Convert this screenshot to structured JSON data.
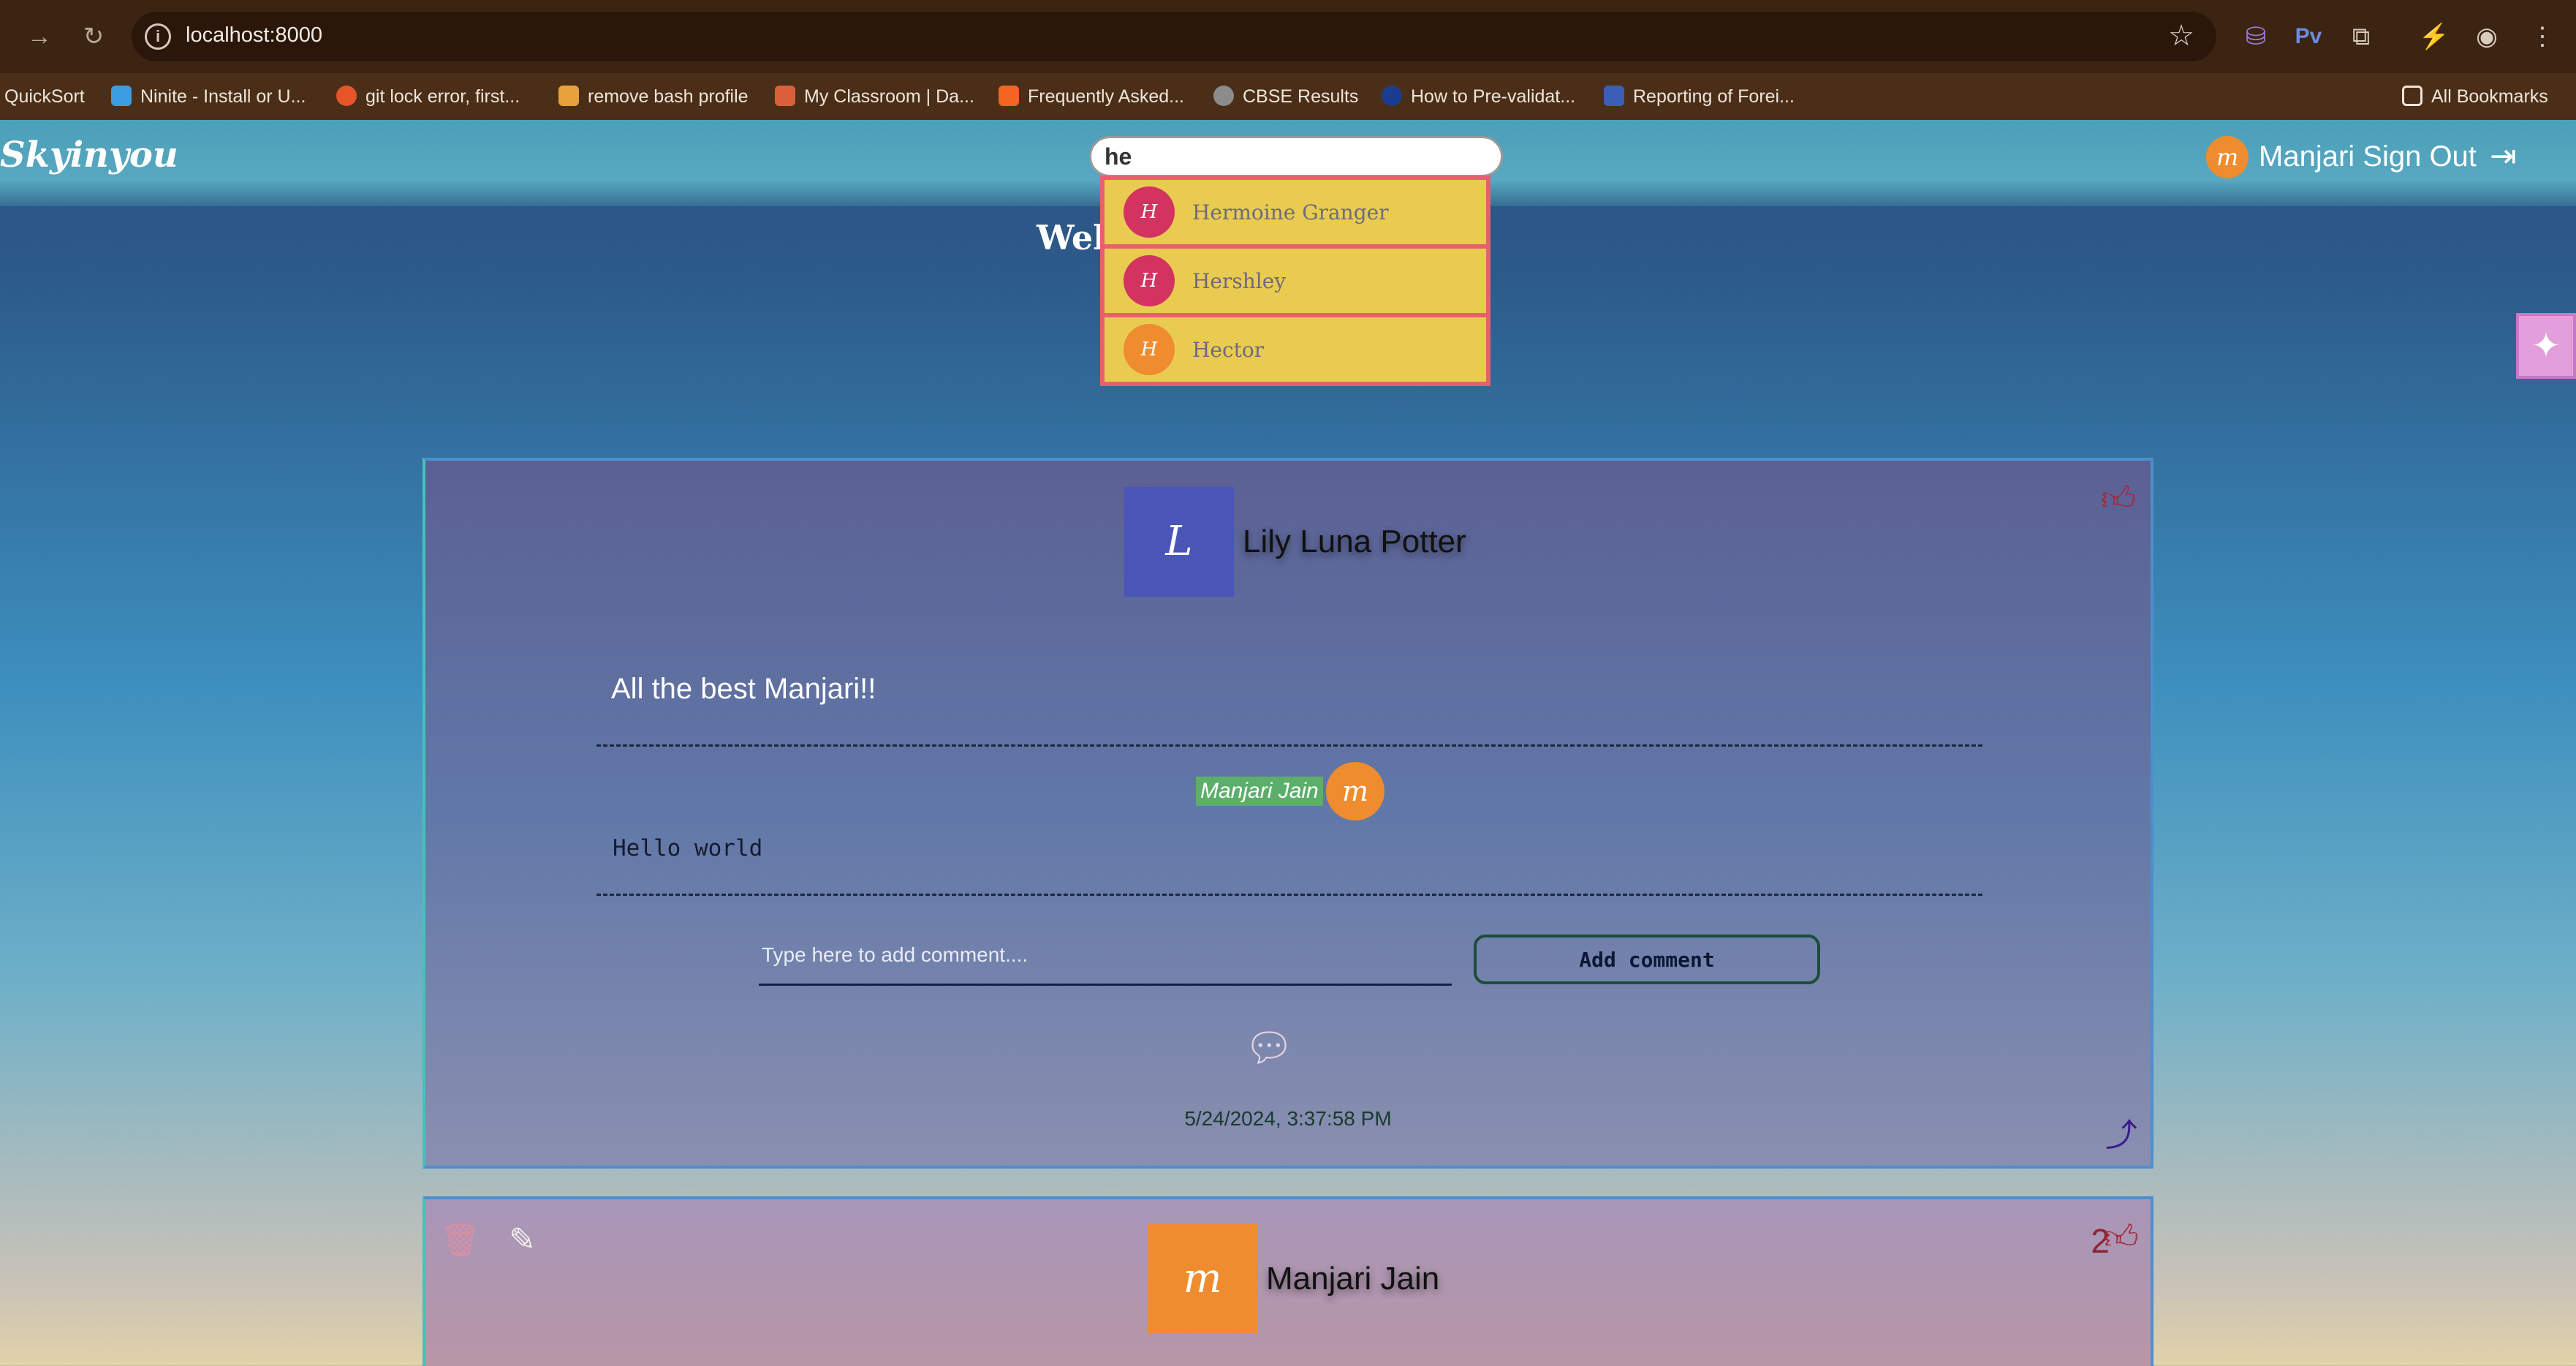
{
  "browser": {
    "url": "localhost:8000",
    "bookmarks": [
      {
        "label": "QuickSort",
        "color": ""
      },
      {
        "label": "Ninite - Install or U...",
        "color": "#3c9ee0"
      },
      {
        "label": "git lock error, first...",
        "color": "#e7552b"
      },
      {
        "label": "remove bash profile",
        "color": "#e8a23b"
      },
      {
        "label": "My Classroom | Da...",
        "color": "#d9603b"
      },
      {
        "label": "Frequently Asked...",
        "color": "#f26522"
      },
      {
        "label": "CBSE Results",
        "color": "#8c8c8c"
      },
      {
        "label": "How to Pre-validat...",
        "color": "#1a3d8f"
      },
      {
        "label": "Reporting of Forei...",
        "color": "#3a5fb5"
      }
    ],
    "all_bookmarks": "All Bookmarks"
  },
  "header": {
    "logo": "Skyinyou",
    "search_value": "he",
    "user_initial": "m",
    "user_name": "Manjari Sign Out"
  },
  "suggestions": [
    {
      "initial": "H",
      "name": "Hermoine Granger",
      "color": "#d2335f"
    },
    {
      "initial": "H",
      "name": "Hershley",
      "color": "#d2335f"
    },
    {
      "initial": "H",
      "name": "Hector",
      "color": "#ef8c2f"
    }
  ],
  "welcome": "Wel",
  "post1": {
    "author_initial": "L",
    "author_name": "Lily Luna Potter",
    "author_color": "#4a55b8",
    "text": "All the best Manjari!!",
    "comment": {
      "author": "Manjari Jain",
      "initial": "m",
      "text": "Hello world"
    },
    "comment_placeholder": "Type here to add comment....",
    "add_comment_label": "Add comment",
    "timestamp": "5/24/2024, 3:37:58 PM"
  },
  "post2": {
    "author_initial": "m",
    "author_name": "Manjari Jain",
    "author_color": "#ef8c2f",
    "likes": "2"
  }
}
